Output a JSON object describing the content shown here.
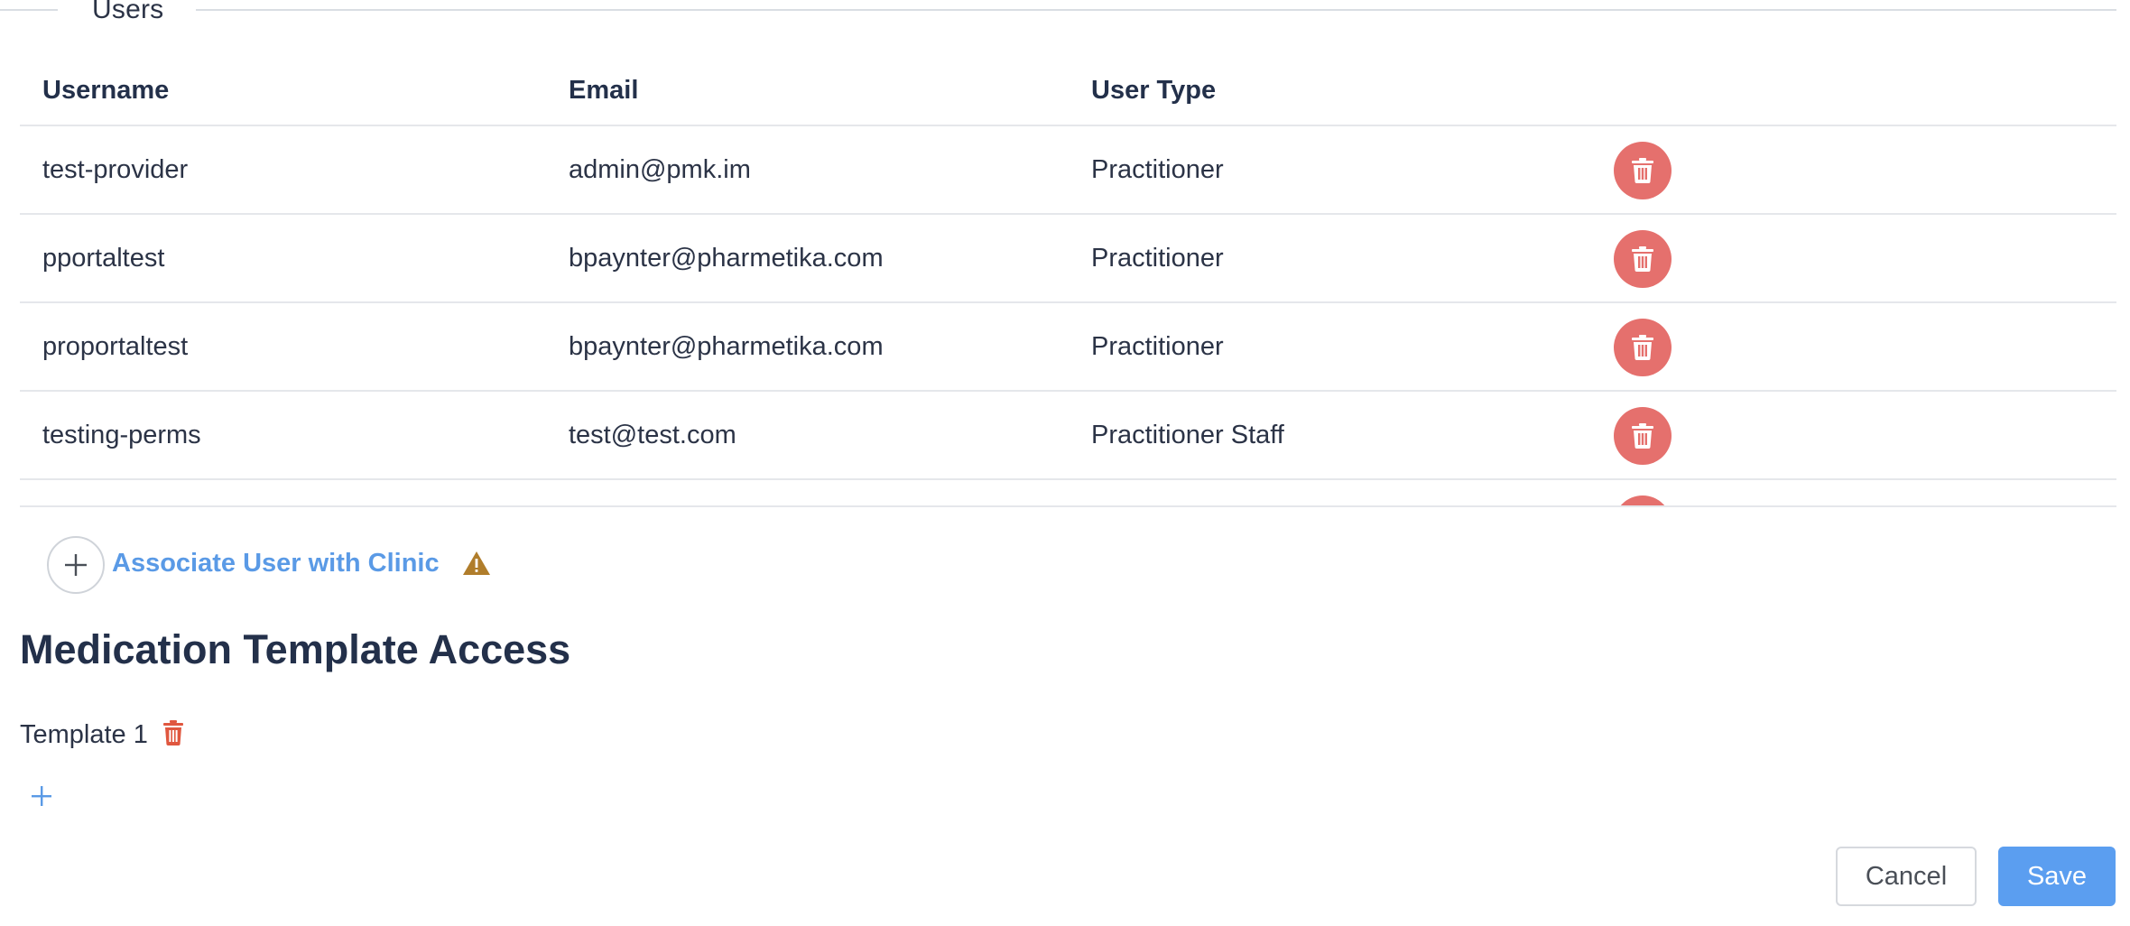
{
  "users_section": {
    "legend": "Users",
    "columns": [
      "Username",
      "Email",
      "User Type"
    ],
    "rows": [
      {
        "username": "test-provider",
        "email": "admin@pmk.im",
        "user_type": "Practitioner"
      },
      {
        "username": "pportaltest",
        "email": "bpaynter@pharmetika.com",
        "user_type": "Practitioner"
      },
      {
        "username": "proportaltest",
        "email": "bpaynter@pharmetika.com",
        "user_type": "Practitioner"
      },
      {
        "username": "testing-perms",
        "email": "test@test.com",
        "user_type": "Practitioner Staff"
      },
      {
        "username": "",
        "email": "",
        "user_type": ""
      }
    ],
    "delete_icon": "trash-icon"
  },
  "associate": {
    "label": "Associate User with Clinic",
    "add_icon": "plus-icon",
    "warning_icon": "warning-icon"
  },
  "medication": {
    "title": "Medication Template Access",
    "templates": [
      {
        "label": "Template 1"
      }
    ],
    "delete_icon": "trash-icon",
    "add_icon": "plus-icon"
  },
  "footer": {
    "cancel_label": "Cancel",
    "save_label": "Save"
  },
  "colors": {
    "delete_red": "#e5706d",
    "link_blue": "#5a9ae6",
    "primary_blue": "#5b9ef0",
    "warning_brown": "#b07d2b",
    "template_delete_red": "#e0573f"
  }
}
